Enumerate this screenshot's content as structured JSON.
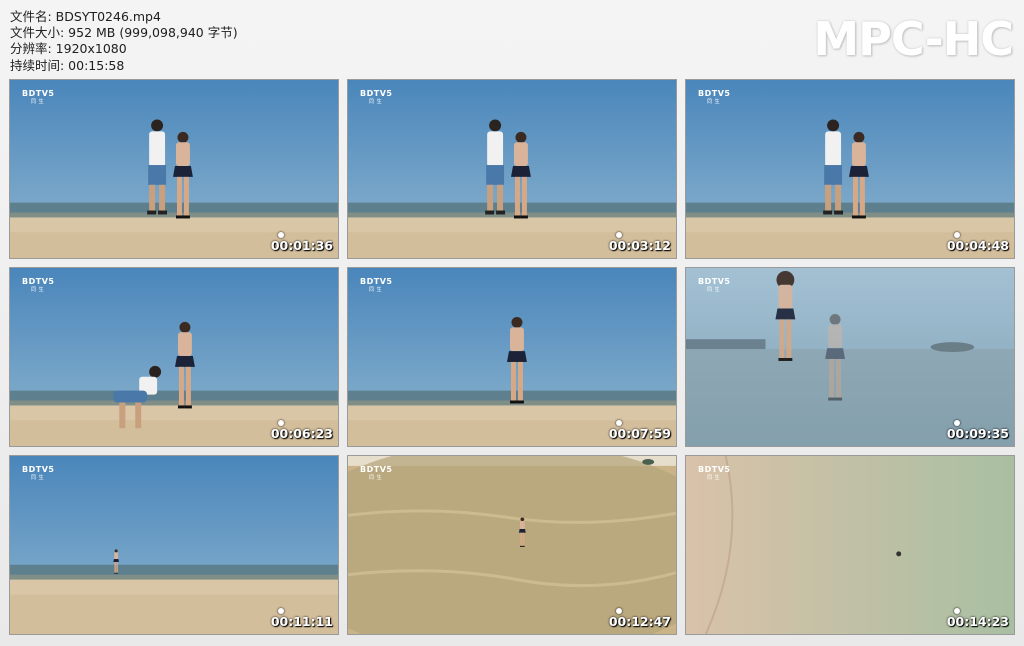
{
  "file_info": {
    "filename": "文件名: BDSYT0246.mp4",
    "filesize": "文件大小: 952 MB (999,098,940 字节)",
    "resolution": "分辨率: 1920x1080",
    "duration": "持续时间: 00:15:58"
  },
  "brand": "MPC-HC",
  "channel_logo": "BDTV5",
  "channel_sub": "同 生",
  "thumbnails": [
    {
      "timestamp": "00:01:36",
      "scene": "beach-couple"
    },
    {
      "timestamp": "00:03:12",
      "scene": "beach-couple"
    },
    {
      "timestamp": "00:04:48",
      "scene": "beach-couple"
    },
    {
      "timestamp": "00:06:23",
      "scene": "beach-crouch"
    },
    {
      "timestamp": "00:07:59",
      "scene": "beach-woman"
    },
    {
      "timestamp": "00:09:35",
      "scene": "water-overlay"
    },
    {
      "timestamp": "00:11:11",
      "scene": "beach-far"
    },
    {
      "timestamp": "00:12:47",
      "scene": "aerial-water"
    },
    {
      "timestamp": "00:14:23",
      "scene": "aerial-sand"
    }
  ]
}
